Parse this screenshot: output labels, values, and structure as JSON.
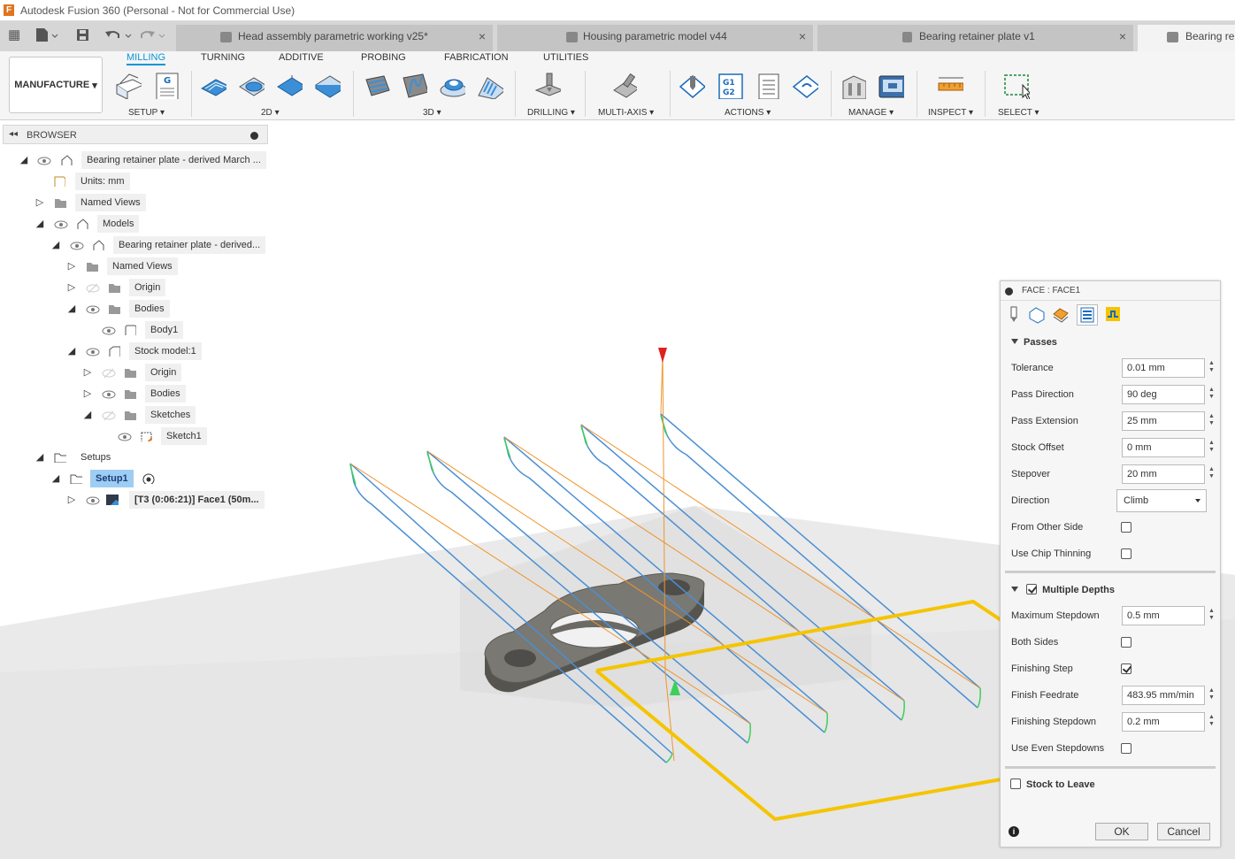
{
  "window": {
    "title": "Autodesk Fusion 360 (Personal - Not for Commercial Use)",
    "logo_letter": "F"
  },
  "tabs": [
    {
      "label": "Head assembly parametric working v25*",
      "close": "×"
    },
    {
      "label": "Housing parametric model v44",
      "close": "×"
    },
    {
      "label": "Bearing retainer plate v1",
      "close": "×"
    },
    {
      "label": "Bearing re",
      "close": ""
    }
  ],
  "ribbon": {
    "workspace": "MANUFACTURE",
    "tabs": [
      "MILLING",
      "TURNING",
      "ADDITIVE",
      "PROBING",
      "FABRICATION",
      "UTILITIES"
    ],
    "groups": [
      "SETUP",
      "2D",
      "3D",
      "DRILLING",
      "MULTI-AXIS",
      "ACTIONS",
      "MANAGE",
      "INSPECT",
      "SELECT"
    ],
    "nc_icon_letter": "G",
    "gcode_icon_text": "G1 G2"
  },
  "browser": {
    "title": "BROWSER",
    "nodes": [
      {
        "label": "Bearing retainer plate - derived March ..."
      },
      {
        "label": "Units: mm"
      },
      {
        "label": "Named Views"
      },
      {
        "label": "Models"
      },
      {
        "label": "Bearing retainer plate - derived..."
      },
      {
        "label": "Named Views"
      },
      {
        "label": "Origin"
      },
      {
        "label": "Bodies"
      },
      {
        "label": "Body1"
      },
      {
        "label": "Stock model:1"
      },
      {
        "label": "Origin"
      },
      {
        "label": "Bodies"
      },
      {
        "label": "Sketches"
      },
      {
        "label": "Sketch1"
      },
      {
        "label": "Setups"
      },
      {
        "label": "Setup1"
      },
      {
        "label": "[T3 (0:06:21)] Face1 (50m..."
      }
    ]
  },
  "dialog": {
    "title": "FACE : FACE1",
    "section_passes": "Passes",
    "tolerance": {
      "label": "Tolerance",
      "value": "0.01 mm"
    },
    "pass_direction": {
      "label": "Pass Direction",
      "value": "90 deg"
    },
    "pass_extension": {
      "label": "Pass Extension",
      "value": "25 mm"
    },
    "stock_offset": {
      "label": "Stock Offset",
      "value": "0 mm"
    },
    "stepover": {
      "label": "Stepover",
      "value": "20 mm"
    },
    "direction": {
      "label": "Direction",
      "value": "Climb"
    },
    "from_other_side": {
      "label": "From Other Side",
      "checked": false
    },
    "use_chip_thinning": {
      "label": "Use Chip Thinning",
      "checked": false
    },
    "section_multiple_depths": {
      "label": "Multiple Depths",
      "checked": true
    },
    "maximum_stepdown": {
      "label": "Maximum Stepdown",
      "value": "0.5 mm"
    },
    "both_sides": {
      "label": "Both Sides",
      "checked": false
    },
    "finishing_step": {
      "label": "Finishing Step",
      "checked": true
    },
    "finish_feedrate": {
      "label": "Finish Feedrate",
      "value": "483.95 mm/min"
    },
    "finishing_stepdown": {
      "label": "Finishing Stepdown",
      "value": "0.2 mm"
    },
    "use_even_stepdowns": {
      "label": "Use Even Stepdowns",
      "checked": false
    },
    "section_stock_to_leave": {
      "label": "Stock to Leave",
      "checked": false
    },
    "ok": "OK",
    "cancel": "Cancel",
    "info_glyph": "i"
  },
  "colors": {
    "accent_blue": "#0696d7",
    "toolpath_blue": "#4a8fd4",
    "toolpath_green": "#3ccf5a",
    "lead_orange": "#f0952a",
    "stock_boundary_yellow": "#f5c400",
    "part_gray": "#6e6d67",
    "rapid_red": "#e02020"
  }
}
